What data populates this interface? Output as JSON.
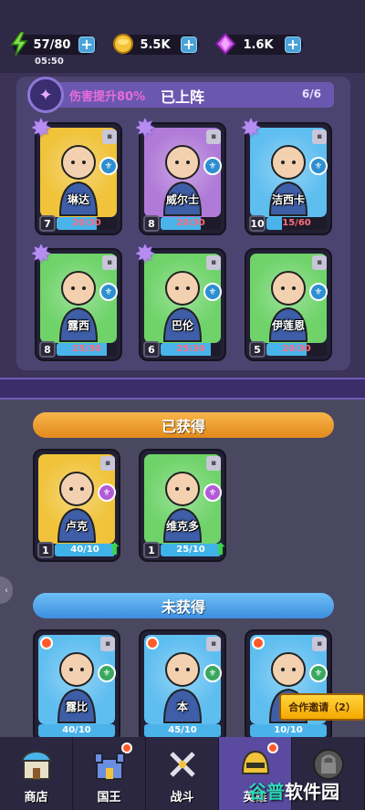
{
  "resources": {
    "energy": {
      "value": "57/80",
      "timer": "05:50",
      "icon": "lightning-icon"
    },
    "gold": {
      "value": "5.5K",
      "icon": "coin-icon"
    },
    "gems": {
      "value": "1.6K",
      "icon": "gem-icon"
    }
  },
  "deployed": {
    "boost": "伤害提升80%",
    "title": "已上阵",
    "count": "6/6",
    "heroes": [
      {
        "name": "琳达",
        "level": "7",
        "progress": "20/30",
        "fraction": 0.67,
        "color": "#f0c33a"
      },
      {
        "name": "威尔士",
        "level": "8",
        "progress": "20/30",
        "fraction": 0.67,
        "color": "#b07ad8"
      },
      {
        "name": "洁西卡",
        "level": "10",
        "progress": "15/60",
        "fraction": 0.25,
        "color": "#5fbef0"
      },
      {
        "name": "露西",
        "level": "8",
        "progress": "25/30",
        "fraction": 0.83,
        "color": "#6fd36a"
      },
      {
        "name": "巴伦",
        "level": "6",
        "progress": "25/30",
        "fraction": 0.83,
        "color": "#6fd36a"
      },
      {
        "name": "伊莲恩",
        "level": "5",
        "progress": "20/30",
        "fraction": 0.67,
        "color": "#6fd36a"
      }
    ]
  },
  "obtained": {
    "title": "已获得",
    "heroes": [
      {
        "name": "卢克",
        "level": "1",
        "progress": "40/10",
        "fraction": 1,
        "color": "#f0c33a"
      },
      {
        "name": "维克多",
        "level": "1",
        "progress": "25/10",
        "fraction": 1,
        "color": "#6fd36a"
      }
    ]
  },
  "not_obtained": {
    "title": "未获得",
    "heroes": [
      {
        "name": "露比",
        "progress": "40/10",
        "fraction": 1,
        "color": "#5fbef0"
      },
      {
        "name": "本",
        "progress": "45/10",
        "fraction": 1,
        "color": "#5fbef0"
      },
      {
        "name": "",
        "progress": "10/10",
        "fraction": 1,
        "color": "#5fbef0"
      }
    ]
  },
  "coop_button": "合作邀请（2）",
  "nav": [
    {
      "label": "商店",
      "icon": "shop-icon"
    },
    {
      "label": "国王",
      "icon": "castle-icon"
    },
    {
      "label": "战斗",
      "icon": "swords-icon"
    },
    {
      "label": "英雄",
      "icon": "helmet-icon"
    },
    {
      "label": "",
      "icon": "locked-icon"
    }
  ],
  "watermark": {
    "brand": "谷普",
    "rest": "软件园"
  }
}
